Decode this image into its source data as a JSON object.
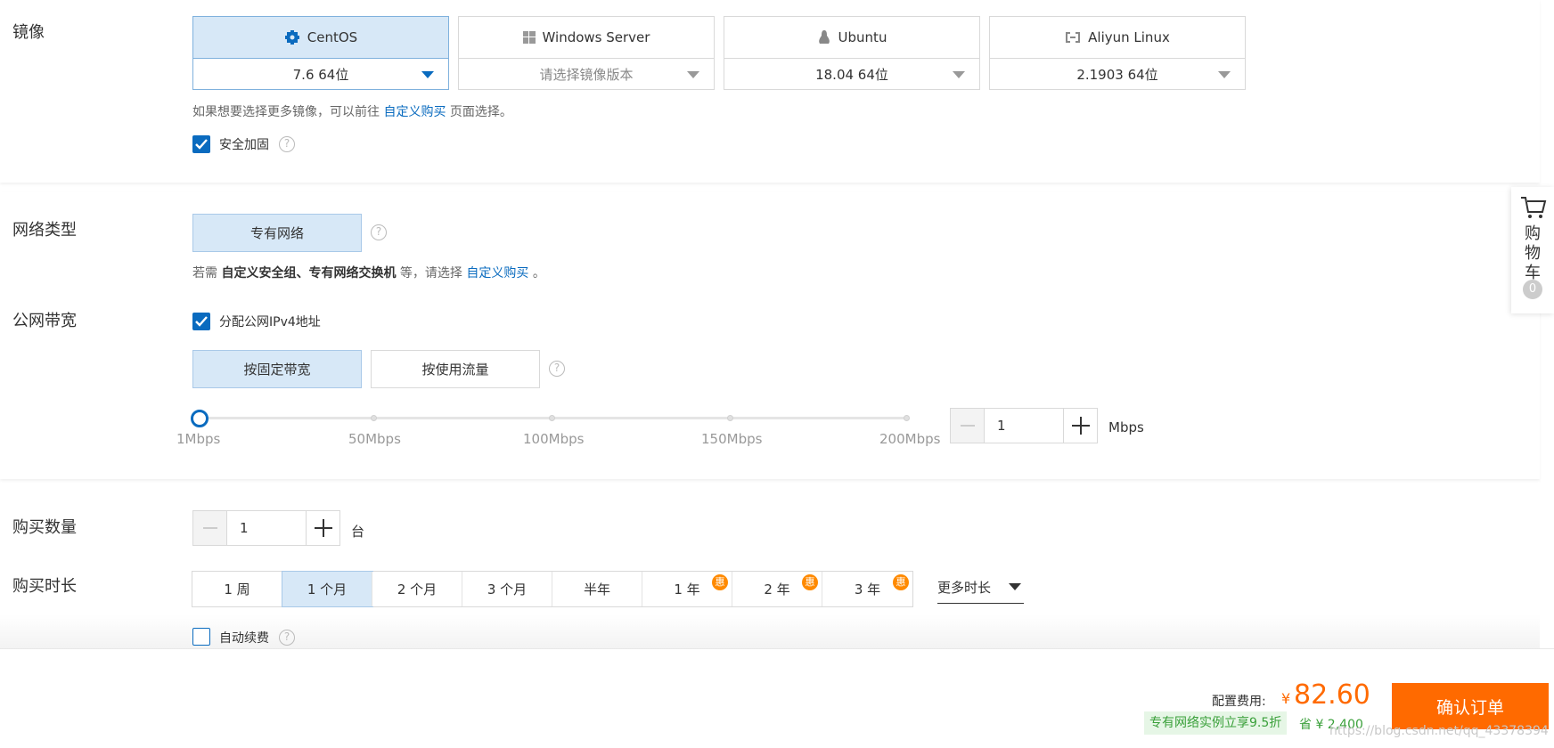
{
  "image": {
    "label": "镜像",
    "os": [
      {
        "name": "CentOS",
        "version": "7.6 64位",
        "selected": true,
        "icon": "centos-icon"
      },
      {
        "name": "Windows Server",
        "version": "请选择镜像版本",
        "selected": false,
        "icon": "windows-icon"
      },
      {
        "name": "Ubuntu",
        "version": "18.04 64位",
        "selected": false,
        "icon": "linux-penguin-icon"
      },
      {
        "name": "Aliyun Linux",
        "version": "2.1903 64位",
        "selected": false,
        "icon": "aliyun-icon"
      }
    ],
    "hint_prefix": "如果想要选择更多镜像，可以前往",
    "hint_link": "自定义购买",
    "hint_suffix": "页面选择。",
    "security_label": "安全加固",
    "security_checked": true
  },
  "network": {
    "type_label": "网络类型",
    "type_option": "专有网络",
    "hint_prefix": "若需",
    "hint_bold": "自定义安全组、专有网络交换机",
    "hint_mid": "等，请选择",
    "hint_link": "自定义购买",
    "hint_suffix": "。",
    "bandwidth_label": "公网带宽",
    "ipv4_label": "分配公网IPv4地址",
    "ipv4_checked": true,
    "billing_fixed": "按固定带宽",
    "billing_traffic": "按使用流量",
    "slider_ticks": [
      "1Mbps",
      "50Mbps",
      "100Mbps",
      "150Mbps",
      "200Mbps"
    ],
    "bandwidth_value": "1",
    "bandwidth_unit": "Mbps"
  },
  "purchase": {
    "quantity_label": "购买数量",
    "quantity_value": "1",
    "quantity_unit": "台",
    "duration_label": "购买时长",
    "durations": [
      {
        "label": "1 周",
        "selected": false,
        "badge": ""
      },
      {
        "label": "1 个月",
        "selected": true,
        "badge": ""
      },
      {
        "label": "2 个月",
        "selected": false,
        "badge": ""
      },
      {
        "label": "3 个月",
        "selected": false,
        "badge": ""
      },
      {
        "label": "半年",
        "selected": false,
        "badge": ""
      },
      {
        "label": "1 年",
        "selected": false,
        "badge": "惠"
      },
      {
        "label": "2 年",
        "selected": false,
        "badge": "惠"
      },
      {
        "label": "3 年",
        "selected": false,
        "badge": "惠"
      }
    ],
    "more_duration": "更多时长",
    "auto_renew_label": "自动续费",
    "auto_renew_checked": false
  },
  "footer": {
    "fee_label": "配置费用:",
    "currency": "¥",
    "amount": "82.60",
    "promo": "专有网络实例立享9.5折",
    "save": "省 ¥ 2,400",
    "confirm": "确认订单",
    "watermark": "https://blog.csdn.net/qq_43378394"
  },
  "cart": {
    "label": "购物车",
    "count": "0"
  },
  "colors": {
    "primary": "#0a6bbf",
    "selected_bg": "#d7e8f7",
    "accent_orange": "#ff6a00",
    "promo_green": "#3aa03a"
  }
}
